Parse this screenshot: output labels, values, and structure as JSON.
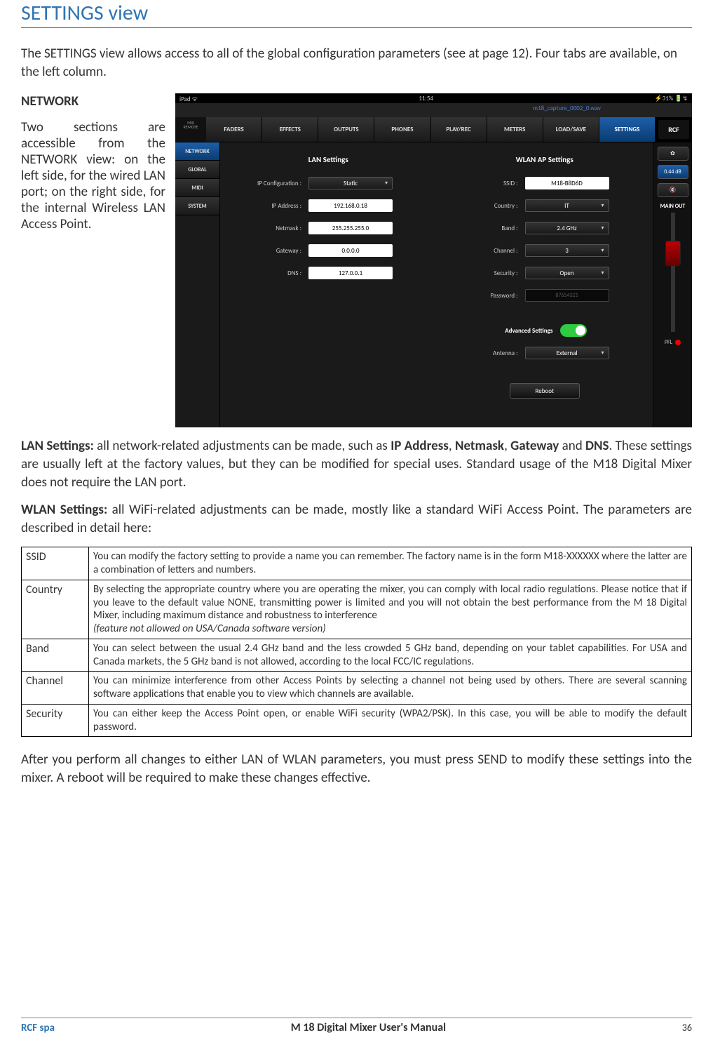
{
  "heading": "SETTINGS view",
  "intro": "The SETTINGS view allows access to all of the global configuration parameters (see at page 12). Four tabs are available, on the left column.",
  "network": {
    "title": "NETWORK",
    "desc": "Two sections are accessible from the NETWORK view: on the left side, for the wired LAN port; on the right side, for the internal Wireless LAN Access Point."
  },
  "screenshot": {
    "statusbar": {
      "left": "iPad ᯤ",
      "center": "11:54",
      "right": "⚡31% 🔋↯"
    },
    "player": {
      "filename": "m18_capture_0002_0.wav"
    },
    "logo_mix_top": "MIX",
    "logo_mix_bottom": "REMOTE",
    "nav": [
      "FADERS",
      "EFFECTS",
      "OUTPUTS",
      "PHONES",
      "PLAY/REC",
      "METERS",
      "LOAD/SAVE",
      "SETTINGS"
    ],
    "brand": "RCF",
    "side_tabs": [
      "NETWORK",
      "GLOBAL",
      "MIDI",
      "SYSTEM"
    ],
    "lan": {
      "title": "LAN Settings",
      "rows": {
        "ipconf_label": "IP Configuration :",
        "ipconf": "Static",
        "ipaddr_label": "IP Address :",
        "ipaddr": "192.168.0.18",
        "netmask_label": "Netmask :",
        "netmask": "255.255.255.0",
        "gateway_label": "Gateway :",
        "gateway": "0.0.0.0",
        "dns_label": "DNS :",
        "dns": "127.0.0.1"
      }
    },
    "wlan": {
      "title": "WLAN AP Settings",
      "rows": {
        "ssid_label": "SSID :",
        "ssid": "M18-B8D6D",
        "country_label": "Country :",
        "country": "IT",
        "band_label": "Band :",
        "band": "2.4 GHz",
        "channel_label": "Channel :",
        "channel": "3",
        "security_label": "Security :",
        "security": "Open",
        "password_label": "Password :",
        "password": "87654321",
        "adv_label": "Advanced Settings",
        "antenna_label": "Antenna :",
        "antenna": "External"
      }
    },
    "reboot": "Reboot",
    "main_out": {
      "gear": "✿",
      "db": "0.44 dB",
      "mute_glyph": "🔇",
      "label": "MAIN OUT",
      "pfl": "PFL"
    }
  },
  "lan_para": {
    "lead": "LAN Settings:",
    "body": " all network-related adjustments can be made, such as ",
    "k1": "IP Address",
    "s1": ", ",
    "k2": "Netmask",
    "s2": ", ",
    "k3": "Gateway",
    "s3": " and ",
    "k4": "DNS",
    "tail": ". These settings are usually left at the factory values, but they can be modified for special uses. Standard usage of the M18 Digital Mixer does not require the LAN port."
  },
  "wlan_para": {
    "lead": "WLAN Settings:",
    "body": " all WiFi-related adjustments can be made, mostly like a standard WiFi Access Point. The parameters are described in detail here:"
  },
  "table": {
    "ssid": {
      "h": "SSID",
      "d": "You can modify the factory setting to provide a name you can remember. The factory name is in the form M18-XXXXXX where the latter are a combination of letters and numbers."
    },
    "country": {
      "h": "Country",
      "d": "By selecting the appropriate country where you are operating the mixer, you can comply with local radio regulations. Please notice that if you leave to the default value NONE, transmitting power is limited and you will not obtain the best performance from the M 18 Digital Mixer, including maximum distance and robustness to interference",
      "note": "(feature not allowed on USA/Canada software version)"
    },
    "band": {
      "h": "Band",
      "d": "You can select between the usual 2.4 GHz band and the less crowded 5 GHz band, depending on your tablet capabilities. For USA and Canada markets, the 5 GHz band is not allowed, according to the local FCC/IC regulations."
    },
    "channel": {
      "h": "Channel",
      "d": "You can minimize interference from other Access Points by selecting a channel not being used by others. There are several scanning software applications that enable you to view which channels are available."
    },
    "security": {
      "h": "Security",
      "d": "You can either keep the Access Point open, or enable WiFi security (WPA2/PSK). In this case, you will be able to modify the default password."
    }
  },
  "after_para": "After you perform all changes to either LAN of WLAN parameters, you must press SEND to modify these settings into the mixer. A reboot will be required to make these changes effective.",
  "footer": {
    "company": "RCF spa",
    "title": "M 18 Digital Mixer User's Manual",
    "page": "36"
  }
}
